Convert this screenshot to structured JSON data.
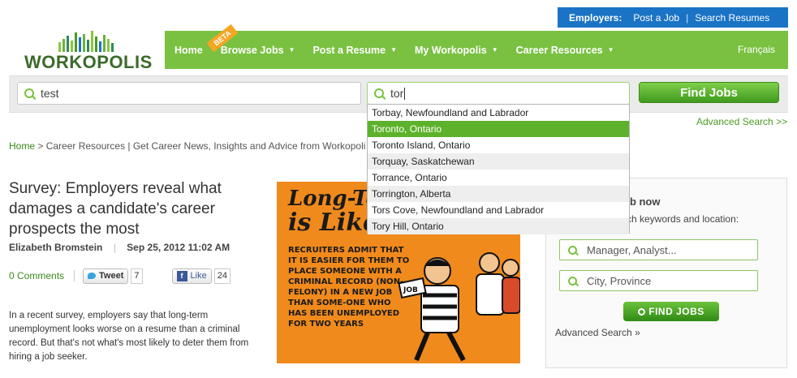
{
  "employers_bar": {
    "label": "Employers:",
    "post_job": "Post a Job",
    "separator": "|",
    "search_resumes": "Search Resumes"
  },
  "logo": {
    "text": "WORKOPOLIS"
  },
  "nav": {
    "items": [
      {
        "label": "Home",
        "caret": false
      },
      {
        "label": "Browse Jobs",
        "caret": true
      },
      {
        "label": "Post a Resume",
        "caret": true
      },
      {
        "label": "My Workopolis",
        "caret": true
      },
      {
        "label": "Career Resources",
        "caret": true
      }
    ],
    "beta_badge": "BETA",
    "language": "Français"
  },
  "search": {
    "keywords_value": "test",
    "location_value": "tor",
    "find_button": "Find Jobs",
    "advanced_link": "Advanced Search >>"
  },
  "autocomplete": {
    "selected_index": 1,
    "items": [
      "Torbay, Newfoundland and Labrador",
      "Toronto, Ontario",
      "Toronto Island, Ontario",
      "Torquay, Saskatchewan",
      "Torrance, Ontario",
      "Torrington, Alberta",
      "Tors Cove, Newfoundland and Labrador",
      "Tory Hill, Ontario"
    ]
  },
  "breadcrumb": {
    "home": "Home",
    "rest": " > Career Resources | Get Career News, Insights and Advice from Workopolis"
  },
  "article": {
    "headline": "Survey: Employers reveal what damages a candidate's career prospects the most",
    "author": "Elizabeth Bromstein",
    "byline_sep": "|",
    "date": "Sep 25, 2012 11:02 AM",
    "comments": "0 Comments",
    "tweet_label": "Tweet",
    "tweet_count": "7",
    "like_label": "Like",
    "like_count": "24",
    "body": "In a recent survey, employers say that long-term unemployment looks worse on a resume than a criminal record. But that's not what's most likely to deter them from hiring a job seeker."
  },
  "illustration": {
    "title_line1": "Long-Te",
    "title_line2": "is Like",
    "text": "RECRUITERS ADMIT THAT IT IS EASIER FOR THEM TO PLACE SOMEONE WITH A CRIMINAL RECORD (NON-FELONY) IN A NEW JOB THAN SOME-ONE WHO HAS BEEN UNEMPLOYED FOR TWO YEARS",
    "sign": "JOB"
  },
  "widget": {
    "title": "ob now",
    "subtitle": "rch keywords and location:",
    "keywords_placeholder": "Manager, Analyst...",
    "location_placeholder": "City, Province",
    "find_button": "FIND JOBS",
    "advanced_link": "Advanced Search »"
  },
  "colors": {
    "brand_green": "#7ac142",
    "employer_blue": "#1a73c5",
    "selection_green": "#5db22b",
    "art_orange": "#f08a1c"
  }
}
